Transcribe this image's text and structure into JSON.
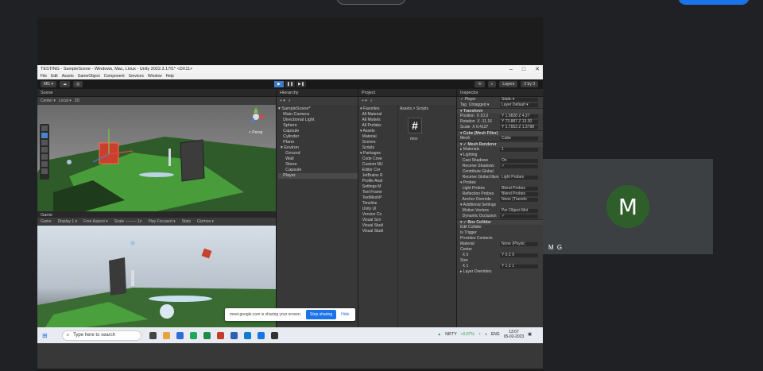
{
  "window": {
    "title": "TESTING - SampleScene - Windows, Mac, Linux - Unity 2022.3.17f1* <DX11>",
    "controls": [
      "–",
      "□",
      "✕"
    ]
  },
  "menu": [
    "File",
    "Edit",
    "Assets",
    "GameObject",
    "Component",
    "Services",
    "Window",
    "Help"
  ],
  "toolbar": {
    "account": "MG ▾",
    "layers": "Layers",
    "layout": "2 by 3"
  },
  "scene": {
    "tab": "Scene",
    "tools": [
      "Center ▾",
      "Local ▾",
      "2D"
    ],
    "persp": "< Persp"
  },
  "game": {
    "tab": "Game",
    "tools": [
      "Game",
      "Display 1 ▾",
      "Free Aspect ▾",
      "Scale ──── 1x",
      "Play Focused ▾",
      "Stats",
      "Gizmos ▾"
    ]
  },
  "hierarchy": {
    "tab": "Hierarchy",
    "items": [
      {
        "label": "▾ SampleScene*"
      },
      {
        "label": "    Main Camera"
      },
      {
        "label": "    Directional Light"
      },
      {
        "label": "    Sphere"
      },
      {
        "label": "    Capsule"
      },
      {
        "label": "    Cylinder"
      },
      {
        "label": "    Plane"
      },
      {
        "label": "  ▾ Environ"
      },
      {
        "label": "      Ground"
      },
      {
        "label": "      Wall"
      },
      {
        "label": "      Stone"
      },
      {
        "label": "      Capsule"
      },
      {
        "label": "    Player"
      }
    ]
  },
  "project": {
    "tab": "Project",
    "breadcrumb": "Assets > Scripts",
    "tree": [
      "▾ Favorites",
      "  All Material",
      "  All Models",
      "  All Prefabs",
      "▾ Assets",
      "  Material",
      "  Scenes",
      "  Scripts",
      "▾ Packages",
      "  Code Cove",
      "  Custom NU",
      "  Editor Cor",
      "  JetBrains R",
      "  Profile Anal",
      "  Settings M",
      "  Test Frame",
      "  TextMeshP",
      "  Timeline",
      "  Unity UI",
      "  Version Co",
      "  Visual Scri",
      "  Visual Studi",
      "  Visual Studi"
    ],
    "file": "mov"
  },
  "inspector": {
    "tab": "Inspector",
    "rows": [
      {
        "label": "✓ Player",
        "value": "Static ▾",
        "comp": false
      },
      {
        "label": "Tag  Untagged ▾",
        "value": "Layer Default ▾",
        "comp": false
      },
      {
        "label": "▾ Transform",
        "value": "",
        "comp": true
      },
      {
        "label": "Position  X 10.3",
        "value": "Y 1.0828  Z 4.27",
        "comp": false
      },
      {
        "label": "Rotation  X -11.16",
        "value": "Y 73.887  Z 13.30",
        "comp": false
      },
      {
        "label": "Scale  X 0.4137",
        "value": "Y 1.7553  Z 1.3798",
        "comp": false
      },
      {
        "label": "▾ Cube (Mesh Filter)",
        "value": "",
        "comp": true
      },
      {
        "label": "Mesh",
        "value": "Cube",
        "comp": false
      },
      {
        "label": "▾ ✓ Mesh Renderer",
        "value": "",
        "comp": true
      },
      {
        "label": "▸ Materials",
        "value": "1",
        "comp": false
      },
      {
        "label": "▾ Lighting",
        "value": "",
        "comp": false
      },
      {
        "label": "  Cast Shadows",
        "value": "On",
        "comp": false
      },
      {
        "label": "  Receive Shadows",
        "value": "✓",
        "comp": false
      },
      {
        "label": "  Contribute Global",
        "value": "",
        "comp": false
      },
      {
        "label": "  Receive Global Illum",
        "value": "Light Probes",
        "comp": false
      },
      {
        "label": "▾ Probes",
        "value": "",
        "comp": false
      },
      {
        "label": "  Light Probes",
        "value": "Blend Probes",
        "comp": false
      },
      {
        "label": "  Reflection Probes",
        "value": "Blend Probes",
        "comp": false
      },
      {
        "label": "  Anchor Override",
        "value": "None (Transfo",
        "comp": false
      },
      {
        "label": "▾ Additional Settings",
        "value": "",
        "comp": false
      },
      {
        "label": "  Motion Vectors",
        "value": "Per Object Mot",
        "comp": false
      },
      {
        "label": "  Dynamic Occlusion",
        "value": "✓",
        "comp": false
      },
      {
        "label": "▾ ✓ Box Collider",
        "value": "",
        "comp": true
      },
      {
        "label": "Edit Collider",
        "value": "",
        "comp": false
      },
      {
        "label": "Is Trigger",
        "value": "",
        "comp": false
      },
      {
        "label": "Provides Contacts",
        "value": "",
        "comp": false
      },
      {
        "label": "Material",
        "value": "None (Physic",
        "comp": false
      },
      {
        "label": "Center",
        "value": "",
        "comp": false
      },
      {
        "label": "  X 0",
        "value": "Y 0   Z 0",
        "comp": false
      },
      {
        "label": "Size",
        "value": "",
        "comp": false
      },
      {
        "label": "  X 1",
        "value": "Y 1   Z 1",
        "comp": false
      },
      {
        "label": "▸ Layer Overrides",
        "value": "",
        "comp": false
      }
    ]
  },
  "share_bar": {
    "text": "meet.google.com is sharing your screen.",
    "stop": "Stop sharing",
    "hide": "Hide"
  },
  "taskbar": {
    "search_placeholder": "Type here to search",
    "stock": "NIFTY",
    "stock_change": "+0.07%",
    "lang": "ENG",
    "time": "13:07",
    "date": "05-02-2023"
  },
  "participant": {
    "initial": "M",
    "name": "M G",
    "avatar_color": "#2e5f2a"
  }
}
